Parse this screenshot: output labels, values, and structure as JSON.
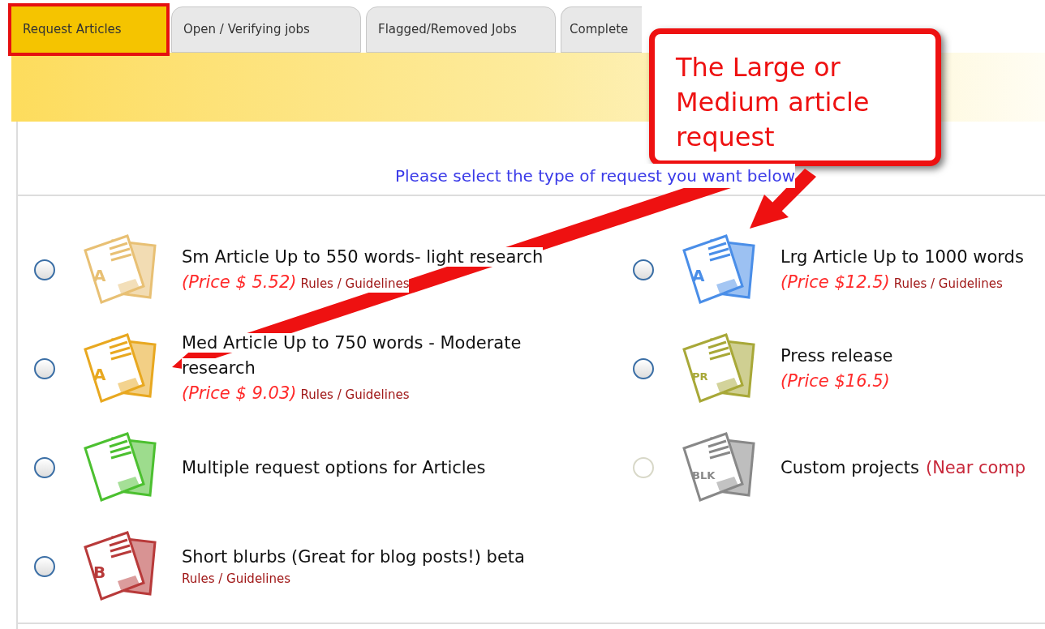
{
  "tabs": [
    {
      "label": "Request Articles",
      "selected": true
    },
    {
      "label": "Open / Verifying jobs",
      "selected": false
    },
    {
      "label": "Flagged/Removed Jobs",
      "selected": false
    },
    {
      "label": "Complete",
      "selected": false
    }
  ],
  "instruction": "Please select the type of request you want below",
  "options": [
    {
      "title": "Sm Article Up to 550 words- light research",
      "price": "(Price $ 5.52)",
      "link": "Rules / Guidelines",
      "icon_letter": "A",
      "color": "#e8c074",
      "selected": false,
      "disabled": false
    },
    {
      "title": "Lrg Article Up to 1000 words",
      "price": "(Price $12.5)",
      "link": "Rules / Guidelines",
      "icon_letter": "A",
      "color": "#4a8ee8",
      "selected": false,
      "disabled": false
    },
    {
      "title": "Med Article Up to 750 words - Moderate research",
      "price": "(Price $ 9.03)",
      "link": "Rules / Guidelines",
      "icon_letter": "A",
      "color": "#e8a820",
      "selected": false,
      "disabled": false
    },
    {
      "title": "Press release",
      "price": "(Price $16.5)",
      "icon_letter": "PR",
      "color": "#a8a838",
      "selected": false,
      "disabled": false
    },
    {
      "title": "Multiple request options for Articles",
      "color": "#4cc030",
      "selected": false,
      "disabled": false
    },
    {
      "title": "Custom projects",
      "note": "(Near comp",
      "icon_letter": "BLK",
      "color": "#888888",
      "selected": false,
      "disabled": true
    },
    {
      "title": "Short blurbs (Great for blog posts!) beta",
      "link": "Rules / Guidelines",
      "icon_letter": "B",
      "color": "#b83a3a",
      "selected": false,
      "disabled": false
    }
  ],
  "callout": {
    "text": "The Large or Medium article request"
  }
}
